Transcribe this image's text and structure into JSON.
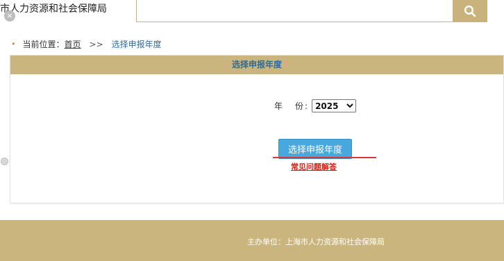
{
  "header": {
    "site_title": "市人力资源和社会保障局",
    "close_glyph": "×",
    "search_icon": "magnifier-icon"
  },
  "breadcrumb": {
    "prefix": "当前位置：",
    "home": "首页",
    "separator": ">>",
    "current": "选择申报年度"
  },
  "panel": {
    "heading": "选择申报年度",
    "year_label_1": "年",
    "year_label_2": "份:",
    "year_selected": "2025",
    "submit_label": "选择申报年度",
    "faq_link": "常见问题解答"
  },
  "footer": {
    "sponsor": "主办单位：上海市人力资源和社会保障局"
  },
  "colors": {
    "gold": "#cbb57e",
    "heading_blue": "#2d6b9b",
    "button_blue": "#46a8dc",
    "link_red": "#d4231a"
  }
}
